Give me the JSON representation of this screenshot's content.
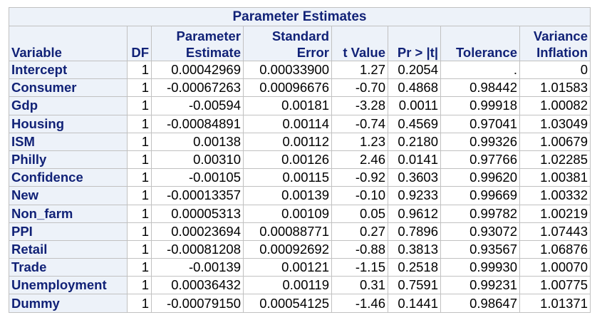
{
  "title": "Parameter Estimates",
  "headers": {
    "variable": "Variable",
    "df": "DF",
    "estimate_line1": "Parameter",
    "estimate_line2": "Estimate",
    "stderr_line1": "Standard",
    "stderr_line2": "Error",
    "tvalue": "t Value",
    "pr": "Pr > |t|",
    "tolerance": "Tolerance",
    "vif_line1": "Variance",
    "vif_line2": "Inflation"
  },
  "rows": [
    {
      "variable": "Intercept",
      "df": "1",
      "estimate": "0.00042969",
      "stderr": "0.00033900",
      "tvalue": "1.27",
      "pr": "0.2054",
      "tolerance": ".",
      "vif": "0"
    },
    {
      "variable": "Consumer",
      "df": "1",
      "estimate": "-0.00067263",
      "stderr": "0.00096676",
      "tvalue": "-0.70",
      "pr": "0.4868",
      "tolerance": "0.98442",
      "vif": "1.01583"
    },
    {
      "variable": "Gdp",
      "df": "1",
      "estimate": "-0.00594",
      "stderr": "0.00181",
      "tvalue": "-3.28",
      "pr": "0.0011",
      "tolerance": "0.99918",
      "vif": "1.00082"
    },
    {
      "variable": "Housing",
      "df": "1",
      "estimate": "-0.00084891",
      "stderr": "0.00114",
      "tvalue": "-0.74",
      "pr": "0.4569",
      "tolerance": "0.97041",
      "vif": "1.03049"
    },
    {
      "variable": "ISM",
      "df": "1",
      "estimate": "0.00138",
      "stderr": "0.00112",
      "tvalue": "1.23",
      "pr": "0.2180",
      "tolerance": "0.99326",
      "vif": "1.00679"
    },
    {
      "variable": "Philly",
      "df": "1",
      "estimate": "0.00310",
      "stderr": "0.00126",
      "tvalue": "2.46",
      "pr": "0.0141",
      "tolerance": "0.97766",
      "vif": "1.02285"
    },
    {
      "variable": "Confidence",
      "df": "1",
      "estimate": "-0.00105",
      "stderr": "0.00115",
      "tvalue": "-0.92",
      "pr": "0.3603",
      "tolerance": "0.99620",
      "vif": "1.00381"
    },
    {
      "variable": "New",
      "df": "1",
      "estimate": "-0.00013357",
      "stderr": "0.00139",
      "tvalue": "-0.10",
      "pr": "0.9233",
      "tolerance": "0.99669",
      "vif": "1.00332"
    },
    {
      "variable": "Non_farm",
      "df": "1",
      "estimate": "0.00005313",
      "stderr": "0.00109",
      "tvalue": "0.05",
      "pr": "0.9612",
      "tolerance": "0.99782",
      "vif": "1.00219"
    },
    {
      "variable": "PPI",
      "df": "1",
      "estimate": "0.00023694",
      "stderr": "0.00088771",
      "tvalue": "0.27",
      "pr": "0.7896",
      "tolerance": "0.93072",
      "vif": "1.07443"
    },
    {
      "variable": "Retail",
      "df": "1",
      "estimate": "-0.00081208",
      "stderr": "0.00092692",
      "tvalue": "-0.88",
      "pr": "0.3813",
      "tolerance": "0.93567",
      "vif": "1.06876"
    },
    {
      "variable": "Trade",
      "df": "1",
      "estimate": "-0.00139",
      "stderr": "0.00121",
      "tvalue": "-1.15",
      "pr": "0.2518",
      "tolerance": "0.99930",
      "vif": "1.00070"
    },
    {
      "variable": "Unemployment",
      "df": "1",
      "estimate": "0.00036432",
      "stderr": "0.00119",
      "tvalue": "0.31",
      "pr": "0.7591",
      "tolerance": "0.99231",
      "vif": "1.00775"
    },
    {
      "variable": "Dummy",
      "df": "1",
      "estimate": "-0.00079150",
      "stderr": "0.00054125",
      "tvalue": "-1.46",
      "pr": "0.1441",
      "tolerance": "0.98647",
      "vif": "1.01371"
    }
  ],
  "colors": {
    "header_bg": "#edf2f9",
    "header_text": "#112277",
    "border": "#c1c1c1",
    "cell_bg": "#ffffff"
  }
}
